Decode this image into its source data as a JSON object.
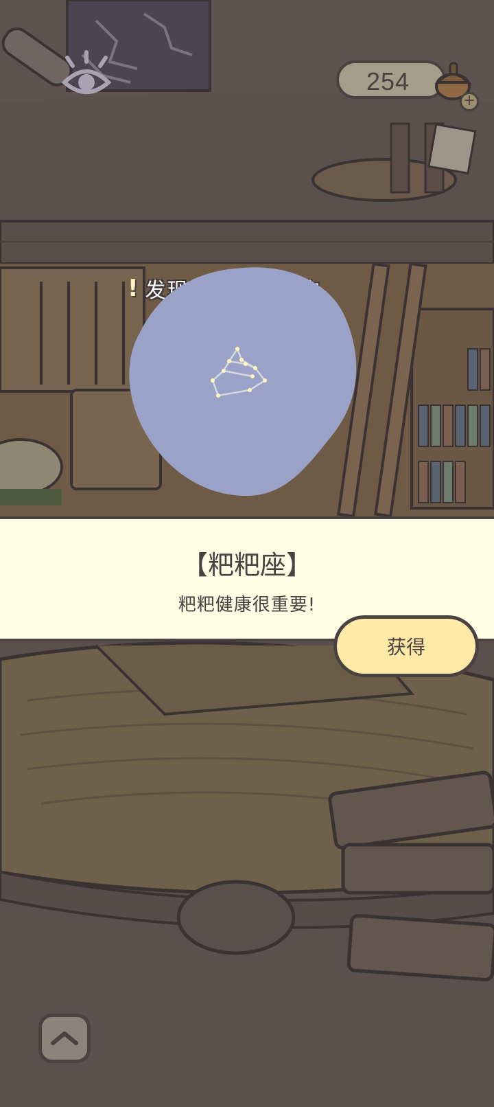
{
  "hud": {
    "acorn_count": "254",
    "add_label": "+"
  },
  "notice": {
    "mark": "!",
    "text": "发现了新的收集物"
  },
  "collectible": {
    "name": "【粑粑座】",
    "description": "粑粑健康很重要!",
    "constellation_icon": "poop-constellation-icon"
  },
  "actions": {
    "get_label": "获得"
  },
  "icons": {
    "eye": "eye-icon",
    "acorn": "acorn-icon",
    "up": "chevron-up-icon"
  },
  "colors": {
    "panel_bg": "#fffde3",
    "button_bg": "#ffe9a6",
    "blob": "#9aa3c7",
    "outline": "#4a4141"
  }
}
